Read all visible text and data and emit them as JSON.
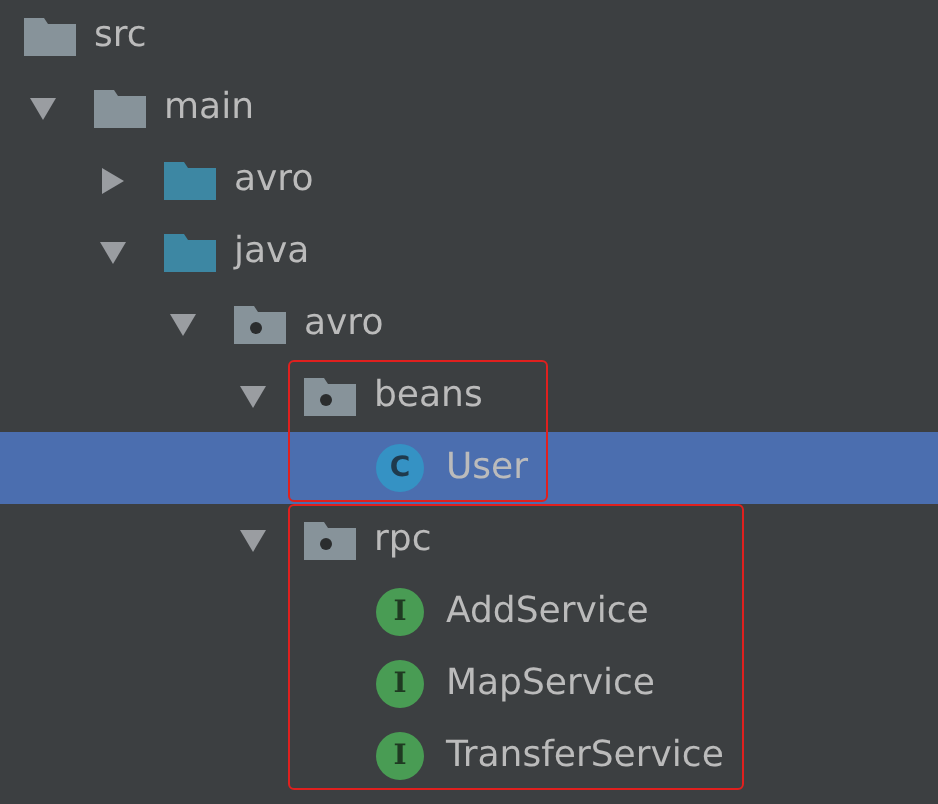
{
  "project_tree": [
    {
      "label": "src",
      "kind": "folder",
      "selected": false,
      "outlined": false,
      "children": [
        {
          "label": "main",
          "kind": "folder",
          "expanded": true,
          "selected": false,
          "outlined": false,
          "children": [
            {
              "label": "avro",
              "kind": "source-folder",
              "expanded": false,
              "selected": false,
              "outlined": false
            },
            {
              "label": "java",
              "kind": "source-folder",
              "expanded": true,
              "selected": false,
              "outlined": false,
              "children": [
                {
                  "label": "avro",
                  "kind": "package",
                  "expanded": true,
                  "selected": false,
                  "outlined": false,
                  "children": [
                    {
                      "label": "beans",
                      "kind": "package",
                      "expanded": true,
                      "selected": false,
                      "outlined": true,
                      "children": [
                        {
                          "label": "User",
                          "kind": "class",
                          "badge": "C",
                          "selected": true,
                          "outlined": false
                        }
                      ]
                    },
                    {
                      "label": "rpc",
                      "kind": "package",
                      "expanded": true,
                      "selected": false,
                      "outlined": true,
                      "children": [
                        {
                          "label": "AddService",
                          "kind": "interface",
                          "badge": "I",
                          "selected": false,
                          "outlined": false
                        },
                        {
                          "label": "MapService",
                          "kind": "interface",
                          "badge": "I",
                          "selected": false,
                          "outlined": false
                        },
                        {
                          "label": "TransferService",
                          "kind": "interface",
                          "badge": "I",
                          "selected": false,
                          "outlined": false
                        }
                      ]
                    }
                  ]
                }
              ]
            }
          ]
        }
      ]
    }
  ]
}
